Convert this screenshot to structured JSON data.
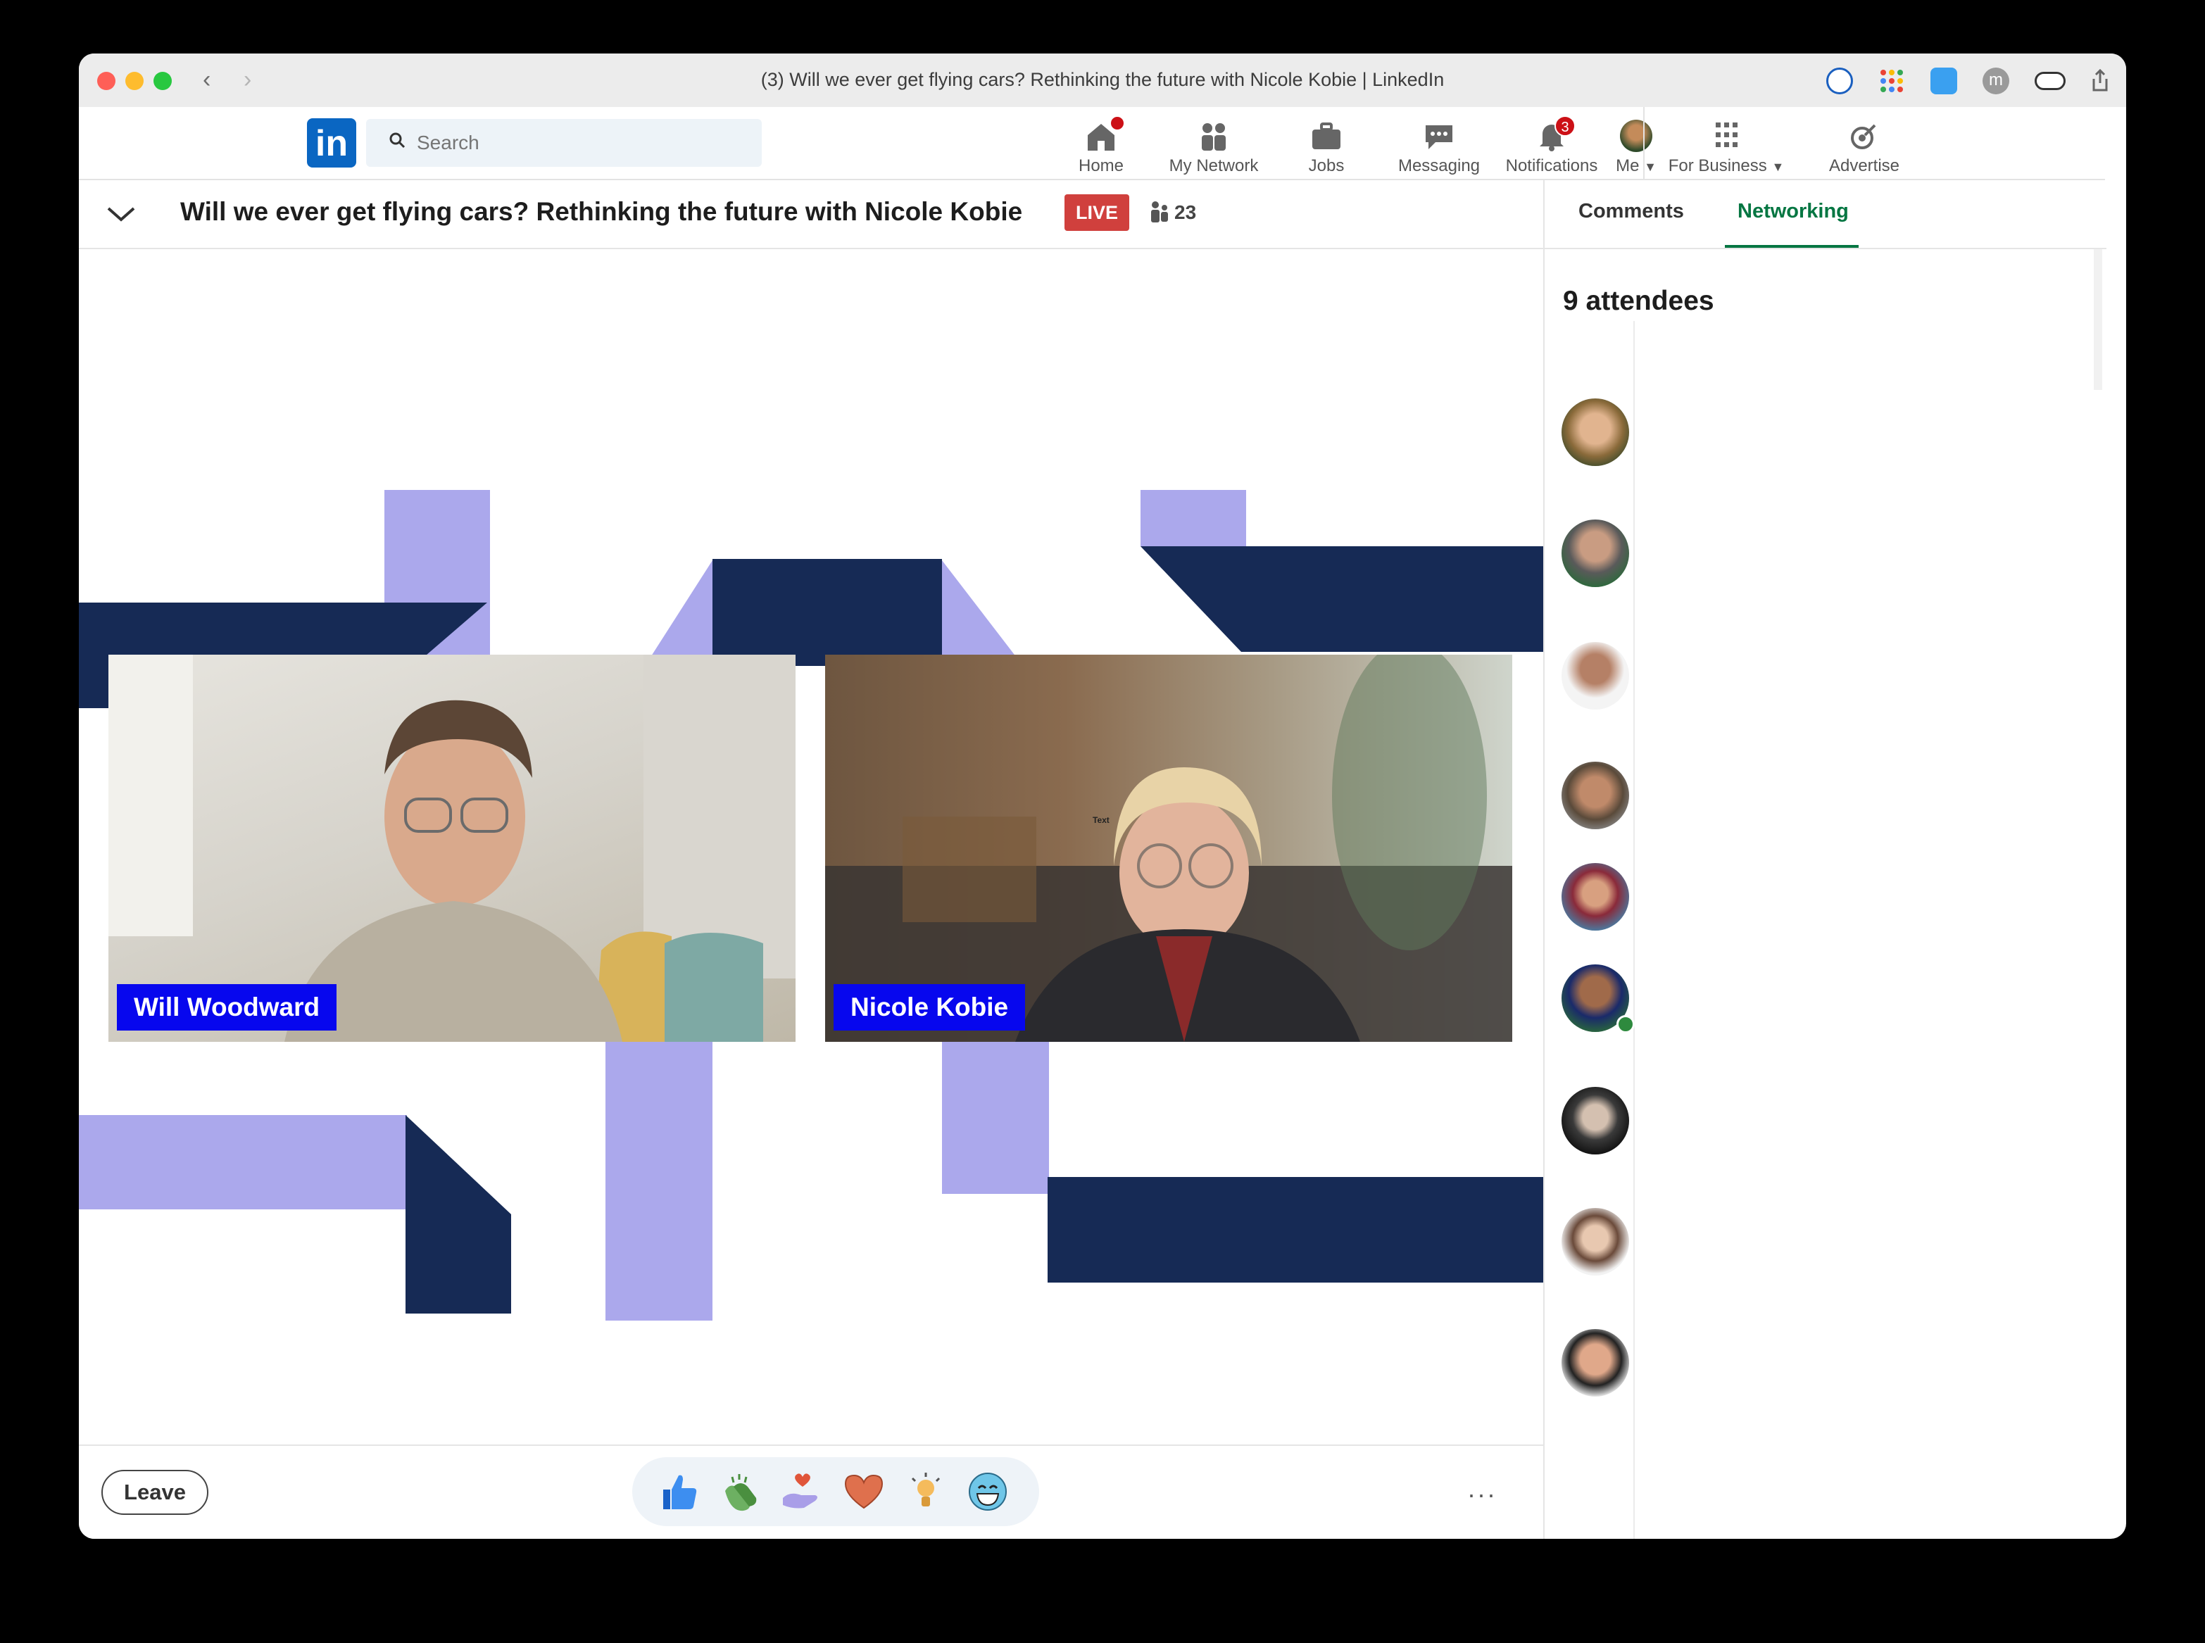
{
  "window": {
    "title": "(3) Will we ever get flying cars? Rethinking the future with Nicole Kobie | LinkedIn"
  },
  "linkedin": {
    "logo": "in",
    "search_placeholder": "Search",
    "nav": [
      {
        "label": "Home",
        "icon": "home-icon"
      },
      {
        "label": "My Network",
        "icon": "network-icon"
      },
      {
        "label": "Jobs",
        "icon": "briefcase-icon"
      },
      {
        "label": "Messaging",
        "icon": "chat-icon"
      },
      {
        "label": "Notifications",
        "icon": "bell-icon",
        "badge": "3"
      },
      {
        "label": "Me",
        "icon": "avatar"
      },
      {
        "label": "For Business",
        "icon": "grid-icon"
      },
      {
        "label": "Advertise",
        "icon": "advertise-icon"
      }
    ]
  },
  "event": {
    "title": "Will we ever get flying cars? Rethinking the future with Nicole Kobie",
    "live_label": "LIVE",
    "viewer_count": "23",
    "speakers": [
      {
        "name": "Will Woodward"
      },
      {
        "name": "Nicole Kobie"
      }
    ],
    "overlay_text": "Text"
  },
  "controls": {
    "leave_label": "Leave",
    "more_label": "···",
    "reactions": [
      "like-icon",
      "clap-icon",
      "support-icon",
      "love-icon",
      "insightful-icon",
      "funny-icon"
    ]
  },
  "panel": {
    "tabs": [
      {
        "label": "Comments",
        "active": false
      },
      {
        "label": "Networking",
        "active": true
      }
    ],
    "attendee_count_label": "9 attendees"
  },
  "colors": {
    "accent_green": "#057642",
    "linkedin_blue": "#0a66c2",
    "live_red": "#d0403d",
    "lavender": "#aba8ec",
    "navy": "#162a55",
    "name_tag_blue": "#0707ee"
  }
}
